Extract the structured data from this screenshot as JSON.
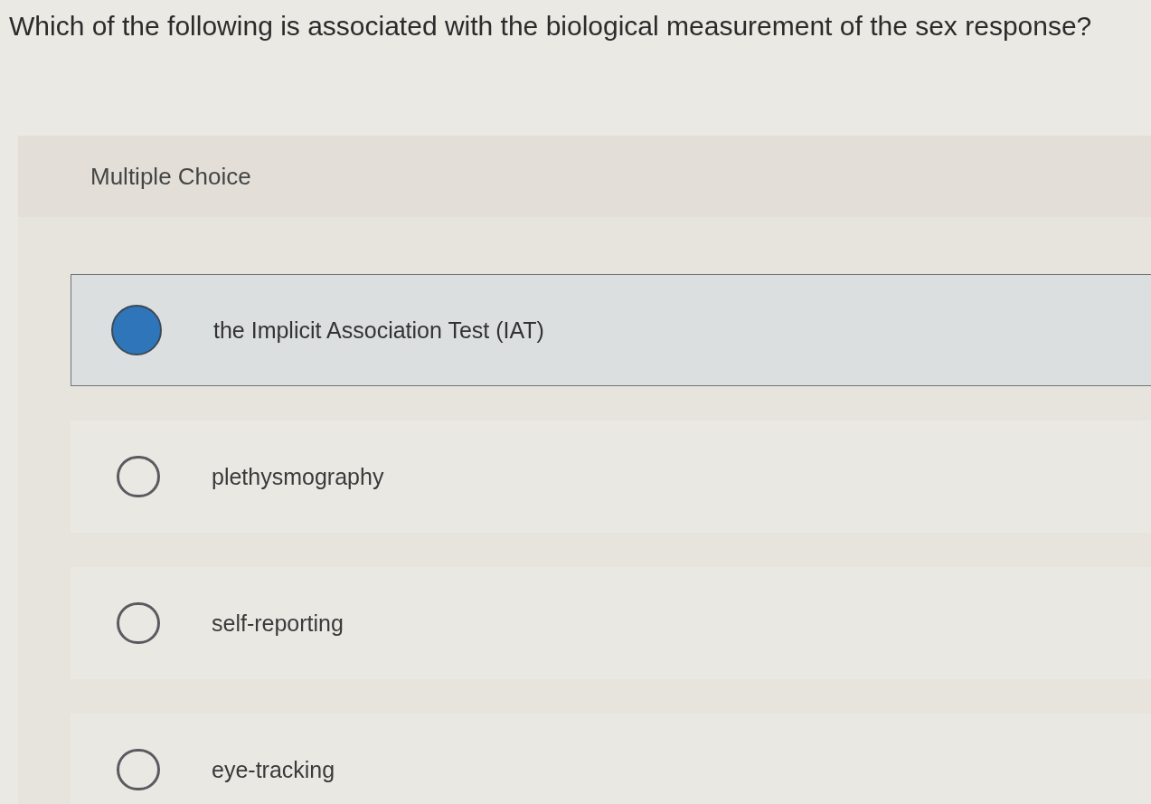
{
  "question": "Which of the following is associated with the biological measurement of the sex response?",
  "question_type": "Multiple Choice",
  "options": [
    {
      "label": "the Implicit Association Test (IAT)",
      "selected": true
    },
    {
      "label": "plethysmography",
      "selected": false
    },
    {
      "label": "self-reporting",
      "selected": false
    },
    {
      "label": "eye-tracking",
      "selected": false
    }
  ]
}
